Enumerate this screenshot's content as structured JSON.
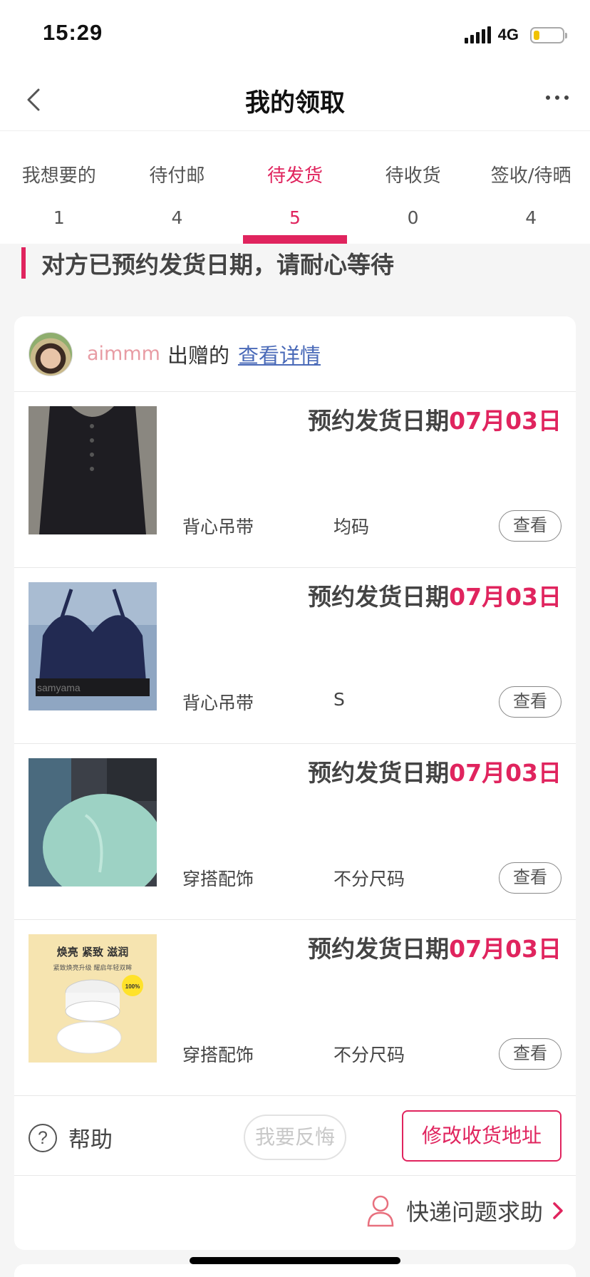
{
  "status_bar": {
    "time": "15:29",
    "network": "4G",
    "battery_level": 0.2,
    "battery_color": "#f0c200"
  },
  "nav": {
    "title": "我的领取",
    "back_icon": "chevron-left-icon",
    "more_icon": "more-horizontal-icon"
  },
  "tabs": [
    {
      "label": "我想要的",
      "count": "1",
      "active": false
    },
    {
      "label": "待付邮",
      "count": "4",
      "active": false
    },
    {
      "label": "待发货",
      "count": "5",
      "active": true
    },
    {
      "label": "待收货",
      "count": "0",
      "active": false
    },
    {
      "label": "签收/待晒",
      "count": "4",
      "active": false
    }
  ],
  "notice": "对方已预约发货日期，请耐心等待",
  "donor": {
    "name": "aimmm",
    "suffix": "出赠的",
    "link": "查看详情"
  },
  "items": [
    {
      "ship_label": "预约发货日期",
      "ship_date": "07月03日",
      "category": "背心吊带",
      "size": "均码",
      "view_label": "查看",
      "thumb": "black-tank-top"
    },
    {
      "ship_label": "预约发货日期",
      "ship_date": "07月03日",
      "category": "背心吊带",
      "size": "S",
      "view_label": "查看",
      "thumb": "navy-bralette",
      "thumb_text": "samyama"
    },
    {
      "ship_label": "预约发货日期",
      "ship_date": "07月03日",
      "category": "穿搭配饰",
      "size": "不分尺码",
      "view_label": "查看",
      "thumb": "mint-compact"
    },
    {
      "ship_label": "预约发货日期",
      "ship_date": "07月03日",
      "category": "穿搭配饰",
      "size": "不分尺码",
      "view_label": "查看",
      "thumb": "cream-jar-ad",
      "thumb_text": {
        "headline": "焕亮  紧致  滋润",
        "sub": "紧致焕亮升级 耀启年轻双眸",
        "badge": "100%"
      }
    }
  ],
  "actions": {
    "help_label": "帮助",
    "regret_label": "我要反悔",
    "address_label": "修改收货地址"
  },
  "express_help": "快递问题求助",
  "colors": {
    "accent": "#e0245e",
    "link": "#4a6ab8",
    "donor_name": "#e89ca4"
  }
}
